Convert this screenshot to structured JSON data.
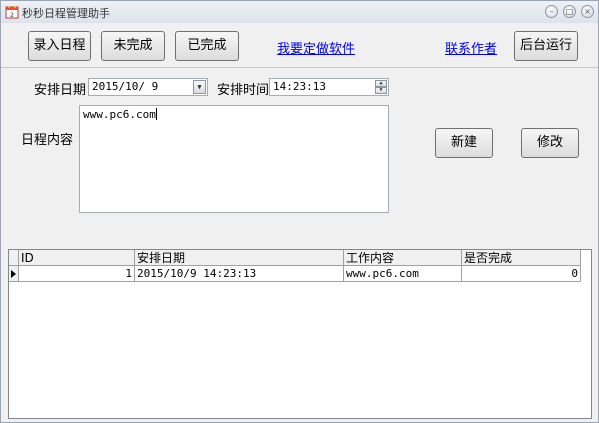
{
  "window": {
    "title": "秒秒日程管理助手",
    "minimize": "–",
    "maximize": "□",
    "close": "×"
  },
  "toolbar": {
    "enter_schedule": "录入日程",
    "not_done": "未完成",
    "done": "已完成",
    "custom_software": "我要定做软件",
    "contact_author": "联系作者",
    "run_background": "后台运行"
  },
  "form": {
    "date_label": "安排日期",
    "date_value": "2015/10/ 9",
    "time_label": "安排时间",
    "time_value": "14:23:13",
    "content_label": "日程内容",
    "content_value": "www.pc6.com",
    "new_button": "新建",
    "edit_button": "修改"
  },
  "table": {
    "columns": [
      "ID",
      "安排日期",
      "工作内容",
      "是否完成"
    ],
    "rows": [
      [
        "1",
        "2015/10/9 14:23:13",
        "www.pc6.com",
        "0"
      ]
    ]
  },
  "colors": {
    "link": "#0000ee",
    "window_bg": "#f0f0f0"
  }
}
